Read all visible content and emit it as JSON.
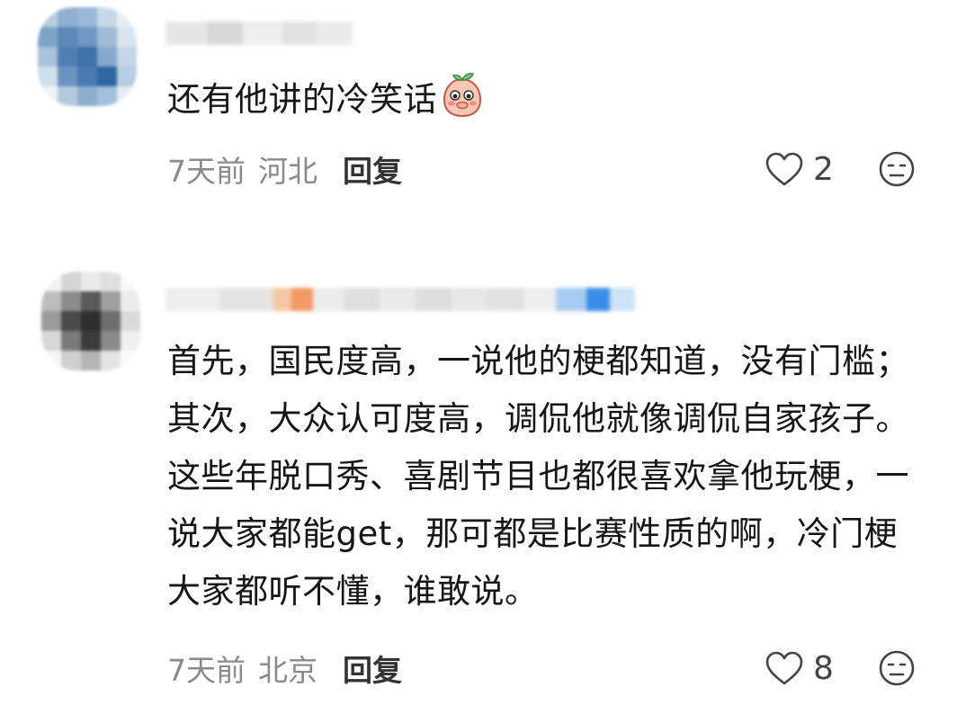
{
  "comments": [
    {
      "text": "还有他讲的冷笑话",
      "emoji": "peach-cover-mouth-emoji",
      "time": "7天前",
      "region": "河北",
      "reply_label": "回复",
      "likes": "2"
    },
    {
      "text": "首先，国民度高，一说他的梗都知道，没有门槛；其次，大众认可度高，调侃他就像调侃自家孩子。这些年脱口秀、喜剧节目也都很喜欢拿他玩梗，一说大家都能get，那可都是比赛性质的啊，冷门梗大家都听不懂，谁敢说。",
      "time": "7天前",
      "region": "北京",
      "reply_label": "回复",
      "likes": "8"
    }
  ],
  "icons": {
    "like": "heart-outline-icon",
    "dislike": "frown-face-icon"
  },
  "colors": {
    "text": "#161616",
    "meta": "#8a8a8a",
    "reply": "#333333"
  }
}
